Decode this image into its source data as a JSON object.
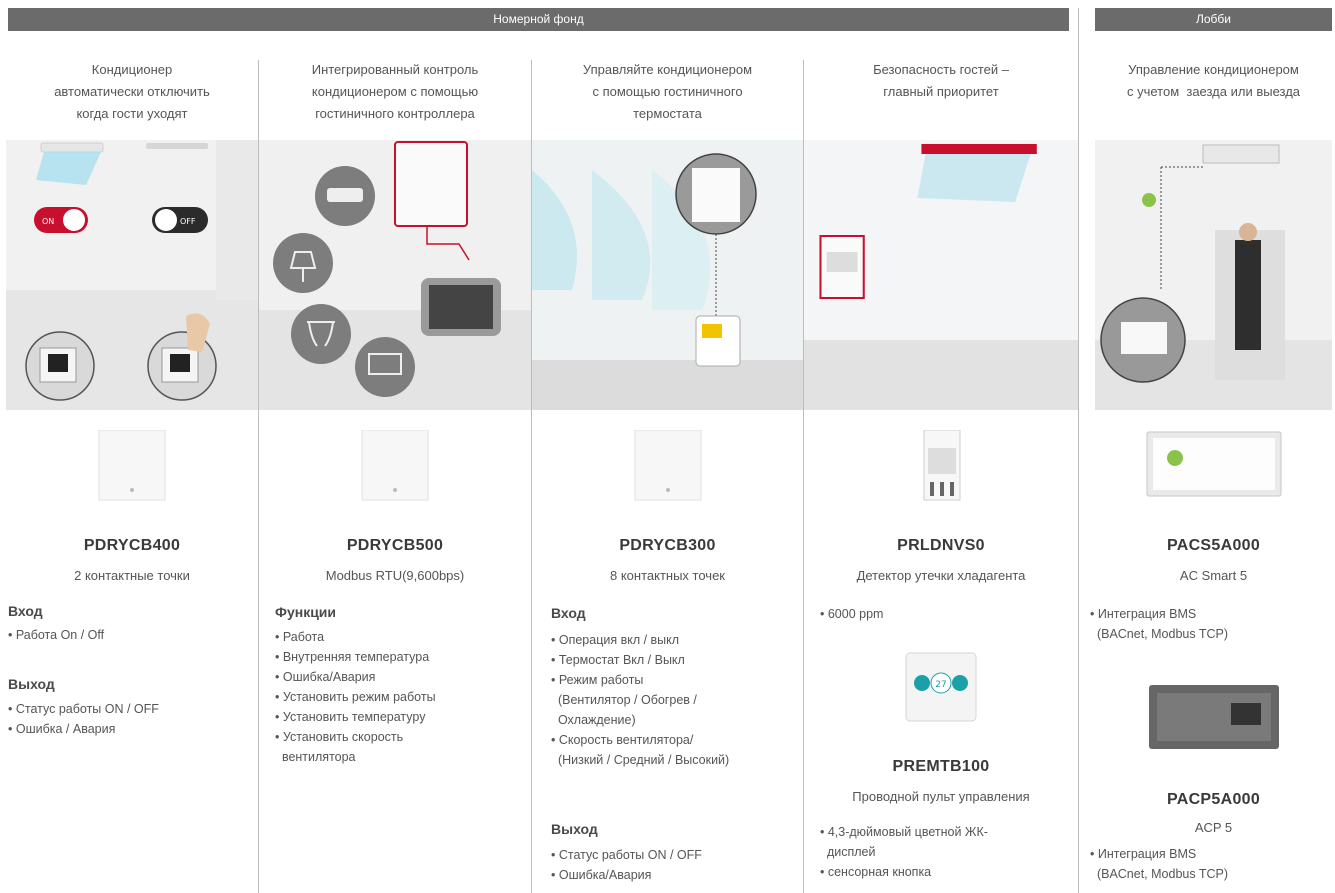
{
  "headers": {
    "room": "Номерной фонд",
    "lobby": "Лобби"
  },
  "colors": {
    "accent": "#c8102e",
    "header_bg": "#6b6b6b",
    "divider": "#bdbdbd"
  },
  "col1": {
    "title": [
      "Кондиционер",
      "автоматически отключить",
      "когда гости уходят"
    ],
    "switch_on": "ON",
    "switch_off": "OFF",
    "model": "PDRYCB400",
    "sub": "2 контактные точки",
    "sec1": "Вход",
    "list1": [
      "• Работа On / Off"
    ],
    "sec2": "Выход",
    "list2": [
      "• Статус работы ON / OFF",
      "• Ошибка / Авария"
    ]
  },
  "col2": {
    "title": [
      "Интегрированный контроль",
      "кондиционером с помощью",
      "гостиничного контроллера"
    ],
    "model": "PDRYCB500",
    "sub": "Modbus RTU(9,600bps)",
    "sec1": "Функции",
    "list1": [
      "• Работа",
      "• Внутренняя температура",
      "• Ошибка/Авария",
      "• Установить режим работы",
      "• Установить температуру",
      "• Установить скорость",
      "  вентилятора"
    ]
  },
  "col3": {
    "title": [
      "Управляйте кондиционером",
      "с помощью гостиничного",
      "термостата"
    ],
    "model": "PDRYCB300",
    "sub": "8 контактных точек",
    "sec1": "Вход",
    "list1": [
      "• Операция вкл / выкл",
      "• Термостат Вкл / Выкл",
      "• Режим работы",
      "  (Вентилятор / Обогрев /",
      "  Охлаждение)",
      "• Скорость вентилятора/",
      "  (Низкий / Средний / Высокий)"
    ],
    "sec2": "Выход",
    "list2": [
      "• Статус работы ON / OFF",
      "• Ошибка/Авария"
    ]
  },
  "col4": {
    "title": [
      "Безопасность гостей –",
      "главный приоритет"
    ],
    "model": "PRLDNVS0",
    "sub": "Детектор утечки хладагента",
    "list1": [
      "• 6000 ppm"
    ],
    "display_value": "27",
    "model2": "PREMTB100",
    "sub2": "Проводной пульт управления",
    "list2": [
      "• 4,3-дюймовый цветной ЖК-",
      "  дисплей",
      "• сенсорная кнопка"
    ]
  },
  "col5": {
    "title": [
      "Управление кондиционером",
      "с учетом  заезда или выезда"
    ],
    "model": "PACS5A000",
    "sub": "AC Smart 5",
    "list1": [
      "• Интеграция BMS",
      "  (BACnet, Modbus TCP)"
    ],
    "model2": "PACP5A000",
    "sub2": "ACP 5",
    "list2": [
      "• Интеграция BMS",
      "  (BACnet, Modbus TCP)"
    ]
  }
}
